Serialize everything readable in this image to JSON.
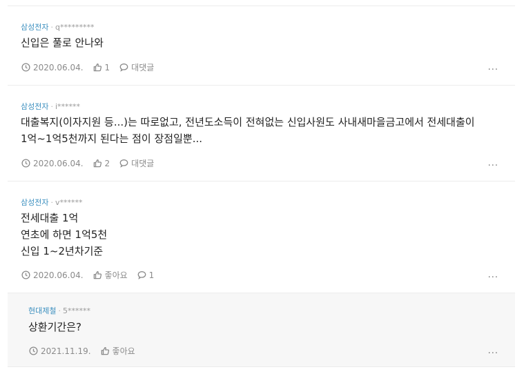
{
  "comments": [
    {
      "company": "삼성전자",
      "user": "q*********",
      "lines": [
        "신입은 풀로 안나와"
      ],
      "date": "2020.06.04.",
      "like_label": "1",
      "reply_label": "대댓글"
    },
    {
      "company": "삼성전자",
      "user": "i******",
      "lines": [
        "대출복지(이자지원 등...)는 따로없고, 전년도소득이 전혀없는 신입사원도 사내새마을금고에서 전세대출이",
        "1억~1억5천까지 된다는 점이 장점일뿐..."
      ],
      "date": "2020.06.04.",
      "like_label": "2",
      "reply_label": "대댓글"
    },
    {
      "company": "삼성전자",
      "user": "v******",
      "lines": [
        "전세대출 1억",
        "연초에 하면 1억5천",
        "신입 1~2년차기준"
      ],
      "date": "2020.06.04.",
      "like_label": "좋아요",
      "reply_label": "1"
    },
    {
      "company": "현대제철",
      "user": "5******",
      "lines": [
        "상환기간은?"
      ],
      "date": "2021.11.19.",
      "like_label": "좋아요"
    }
  ],
  "more_label": "..."
}
